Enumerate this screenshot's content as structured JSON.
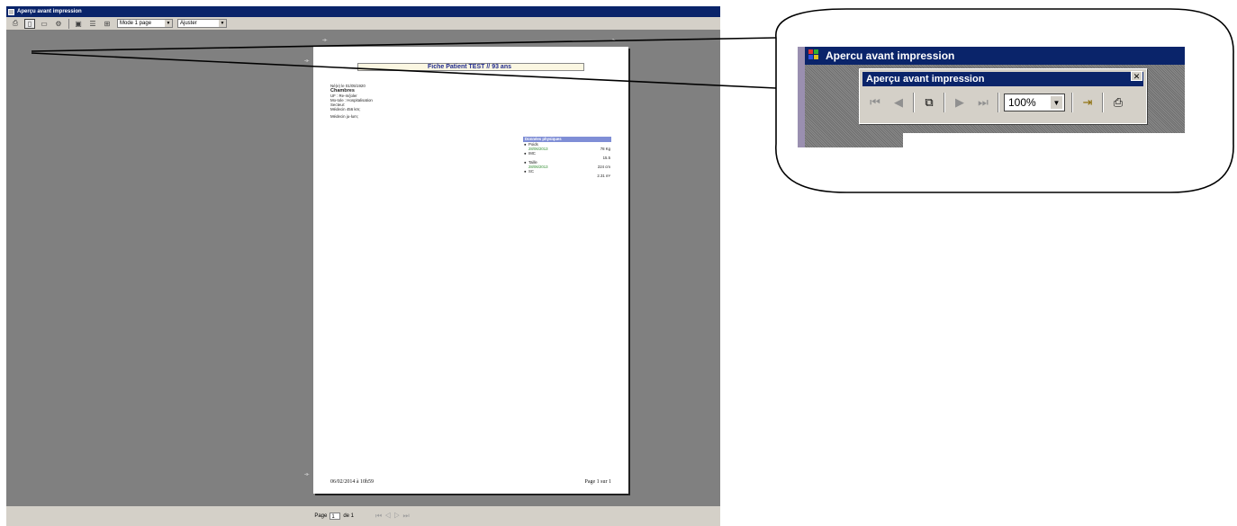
{
  "window": {
    "title": "Aperçu avant impression",
    "toolbar": {
      "mode_value": "Mode 1 page",
      "fit_value": "Ajuster"
    }
  },
  "statusbar": {
    "page_label": "Page",
    "page_value": "1",
    "of_label": "de 1"
  },
  "document": {
    "title": "Fiche Patient TEST // 93 ans",
    "info_lines": [
      "Né(e) le 01/05/1920"
    ],
    "chamber_label": "Chambres",
    "detail_lines": [
      "UF : Re-m/joler",
      "Mo-tole : Hospitalisation",
      "Secteur:",
      "Médecin 456 km;"
    ],
    "extra_line": "Médecin ju-lum;",
    "physical": {
      "header": "Données physiques",
      "items": [
        {
          "label": "Poids",
          "date": "28/06/2013",
          "value": "78 Kg"
        },
        {
          "label": "IMC",
          "date": "",
          "value": "15.5"
        },
        {
          "label": "Taille",
          "date": "28/06/2013",
          "value": "224 cm"
        },
        {
          "label": "SC",
          "date": "",
          "value": "2.31 m²"
        }
      ]
    },
    "footer_left": "06/02/2014 à 10h59",
    "footer_right": "Page 1 sur 1"
  },
  "callout": {
    "window_title": "Apercu avant impression",
    "dialog_title": "Aperçu avant impression",
    "zoom_value": "100%",
    "colors": {
      "titlebar": "#0a246a",
      "face": "#d4d0c8"
    }
  }
}
